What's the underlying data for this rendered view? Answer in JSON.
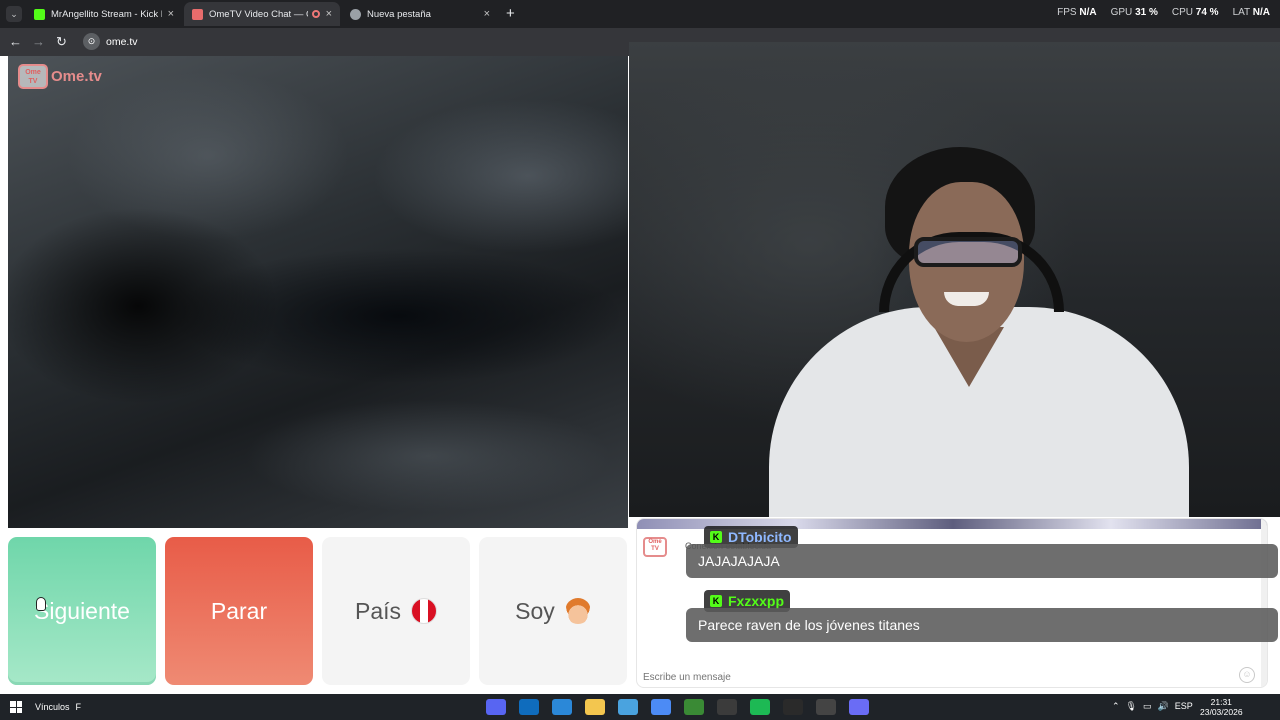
{
  "browser": {
    "tabs": [
      {
        "title": "MrAngellito Stream - Kick Dash",
        "favicon": "kick-icon",
        "active": false
      },
      {
        "title": "OmeTV Video Chat — Ome",
        "favicon": "ometv-icon",
        "active": true
      },
      {
        "title": "Nueva pestaña",
        "favicon": "chrome-icon",
        "active": false
      }
    ],
    "url": "ome.tv",
    "stats": [
      {
        "label": "FPS",
        "value": "N/A"
      },
      {
        "label": "GPU",
        "value": "31 %"
      },
      {
        "label": "CPU",
        "value": "74 %"
      },
      {
        "label": "LAT",
        "value": "N/A"
      }
    ]
  },
  "ometv": {
    "logo_text": "Ome.tv",
    "logo_icon_text": "Ome TV",
    "buttons": {
      "next": "Siguiente",
      "stop": "Parar",
      "country": "País",
      "soy": "Soy"
    },
    "chat": {
      "system_text": "Conexión establecida",
      "input_placeholder": "Escribe un mensaje"
    }
  },
  "overlay": {
    "messages": [
      {
        "user": "DTobicito",
        "user_color": "#8fb8ff",
        "text": "JAJAJAJAJA"
      },
      {
        "user": "Fxzxxpp",
        "user_color": "#53fc18",
        "text": "Parece raven de los jóvenes titanes"
      }
    ]
  },
  "taskbar": {
    "links_label": "Vínculos",
    "links_extra": "F",
    "language": "ESP",
    "time": "21:31",
    "date": "23/03/2026",
    "apps": [
      {
        "name": "discord-icon",
        "color": "#5865f2"
      },
      {
        "name": "outlook-icon",
        "color": "#0f6cbd"
      },
      {
        "name": "store-icon",
        "color": "#2b88d8"
      },
      {
        "name": "explorer-icon",
        "color": "#f3c64f"
      },
      {
        "name": "app-f-icon",
        "color": "#4aa3df"
      },
      {
        "name": "chrome-icon",
        "color": "#4c8bf5"
      },
      {
        "name": "minecraft-icon",
        "color": "#3a8a35"
      },
      {
        "name": "obs-icon",
        "color": "#3b3b3b"
      },
      {
        "name": "spotify-icon",
        "color": "#1db954"
      },
      {
        "name": "epic-icon",
        "color": "#2a2a2a"
      },
      {
        "name": "clock-app-icon",
        "color": "#444444"
      },
      {
        "name": "droplet-icon",
        "color": "#6a6cf5"
      }
    ]
  }
}
